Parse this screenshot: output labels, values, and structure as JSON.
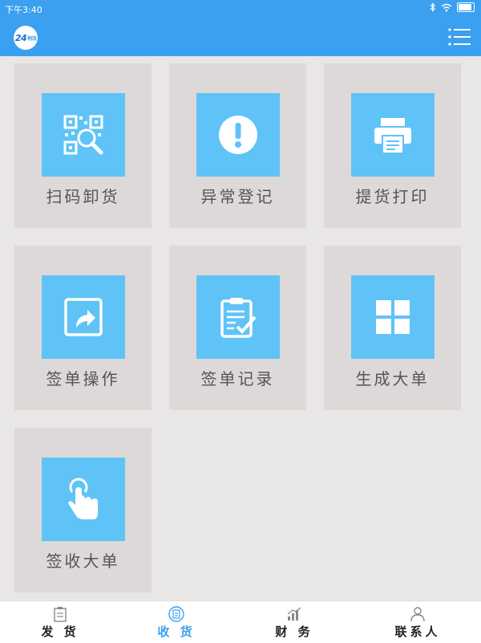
{
  "status_bar": {
    "time": "下午3:40"
  },
  "header": {
    "logo_text": "24",
    "logo_sub": "物流"
  },
  "tiles": [
    {
      "label": "扫码卸货",
      "icon": "qr-scan-icon"
    },
    {
      "label": "异常登记",
      "icon": "exclamation-icon"
    },
    {
      "label": "提货打印",
      "icon": "printer-icon"
    },
    {
      "label": "签单操作",
      "icon": "share-arrow-icon"
    },
    {
      "label": "签单记录",
      "icon": "clipboard-check-icon"
    },
    {
      "label": "生成大单",
      "icon": "grid-icon"
    },
    {
      "label": "签收大单",
      "icon": "tap-hand-icon"
    }
  ],
  "tabs": [
    {
      "label": "发 货",
      "icon": "clipboard-icon",
      "active": false
    },
    {
      "label": "收 货",
      "icon": "receipt-icon",
      "active": true
    },
    {
      "label": "财 务",
      "icon": "bar-chart-icon",
      "active": false
    },
    {
      "label": "联系人",
      "icon": "person-icon",
      "active": false
    }
  ],
  "colors": {
    "primary": "#3aa0ef",
    "tile_icon_bg": "#5fc3f7",
    "tile_bg": "#dcd9d8",
    "page_bg": "#e9e6e6"
  }
}
